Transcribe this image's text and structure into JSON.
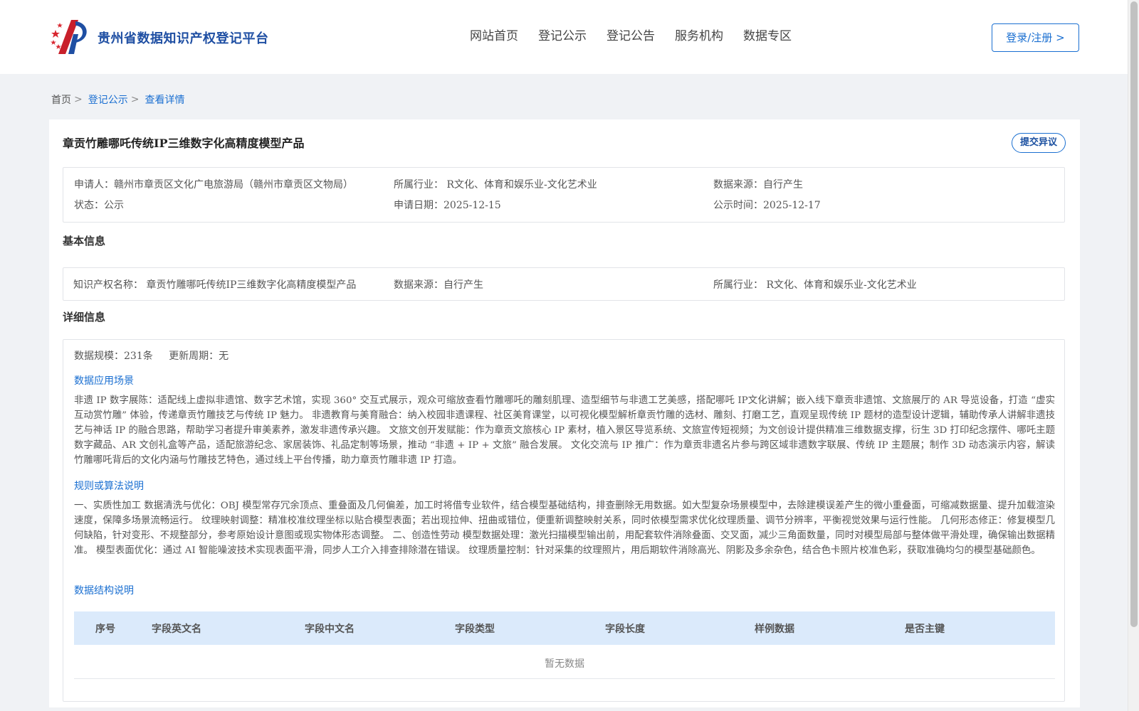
{
  "header": {
    "brand": "贵州省数据知识产权登记平台",
    "nav": [
      "网站首页",
      "登记公示",
      "登记公告",
      "服务机构",
      "数据专区"
    ],
    "login_label": "登录/注册 >"
  },
  "breadcrumb": {
    "home": "首页",
    "sep1": ">",
    "level2": "登记公示",
    "sep2": ">",
    "current": "查看详情"
  },
  "product": {
    "title": "章贡竹雕哪吒传统IP三维数字化高精度模型产品",
    "objection_label": "提交异议"
  },
  "summary": {
    "applicant": "申请人：赣州市章贡区文化广电旅游局（赣州市章贡区文物局）",
    "industry": "所属行业： R文化、体育和娱乐业-文化艺术业",
    "source": "数据来源：自行产生",
    "status": "状态：公示",
    "apply_date": "申请日期：2025-12-15",
    "publish_date": "公示时间：2025-12-17"
  },
  "basic": {
    "heading": "基本信息",
    "ip_name": "知识产权名称： 章贡竹雕哪吒传统IP三维数字化高精度模型产品",
    "source": "数据来源：自行产生",
    "industry": "所属行业： R文化、体育和娱乐业-文化艺术业"
  },
  "detail": {
    "heading": "详细信息",
    "scale": "数据规模：231条",
    "cycle": "更新周期：无",
    "scenario_heading": "数据应用场景",
    "scenario_text": "非遗 IP 数字展陈：适配线上虚拟非遗馆、数字艺术馆，实现 360° 交互式展示，观众可缩放查看竹雕哪吒的雕刻肌理、造型细节与非遗工艺美感，搭配哪吒 IP文化讲解；嵌入线下章贡非遗馆、文旅展厅的 AR 导览设备，打造 “虚实互动赏竹雕” 体验，传递章贡竹雕技艺与传统 IP 魅力。 非遗教育与美育融合：纳入校园非遗课程、社区美育课堂，以可视化模型解析章贡竹雕的选材、雕刻、打磨工艺，直观呈现传统 IP 题材的造型设计逻辑，辅助传承人讲解非遗技艺与神话 IP 的融合思路，帮助学习者提升审美素养，激发非遗传承兴趣。 文旅文创开发赋能：作为章贡文旅核心 IP 素材，植入景区导览系统、文旅宣传短视频；为文创设计提供精准三维数据支撑，衍生 3D 打印纪念摆件、哪吒主题数字藏品、AR 文创礼盒等产品，适配旅游纪念、家居装饰、礼品定制等场景，推动 “非遗 + IP + 文旅” 融合发展。 文化交流与 IP 推广：作为章贡非遗名片参与跨区域非遗数字联展、传统 IP 主题展；制作 3D 动态演示内容，解读竹雕哪吒背后的文化内涵与竹雕技艺特色，通过线上平台传播，助力章贡竹雕非遗 IP 打造。",
    "rules_heading": "规则或算法说明",
    "rules_text": "一、实质性加工 数据清洗与优化：OBJ 模型常存冗余顶点、重叠面及几何偏差，加工时将借专业软件，结合模型基础结构，排查删除无用数据。如大型复杂场景模型中，去除建模误差产生的微小重叠面，可缩减数据量、提升加载渲染速度，保障多场景流畅运行。 纹理映射调整：精准校准纹理坐标以贴合模型表面；若出现拉伸、扭曲或错位，便重新调整映射关系，同时依模型需求优化纹理质量、调节分辨率，平衡视觉效果与运行性能。 几何形态修正：修复模型几何缺陷，针对变形、不规整部分，参考原始设计意图或现实物体形态调整。 二、创造性劳动 模型数据处理：激光扫描模型输出前，用配套软件消除叠面、交叉面，减少三角面数量，同时对模型局部与整体做平滑处理，确保输出数据精准。 模型表面优化：通过 AI 智能噪波技术实现表面平滑，同步人工介入排查排除潜在错误。 纹理质量控制：针对采集的纹理照片，用后期软件消除高光、阴影及多余杂色，结合色卡照片校准色彩，获取准确均匀的模型基础颜色。",
    "structure_heading": "数据结构说明",
    "table_headers": [
      "序号",
      "字段英文名",
      "字段中文名",
      "字段类型",
      "字段长度",
      "样例数据",
      "是否主键"
    ],
    "empty_text": "暂无数据"
  },
  "colors": {
    "accent": "#1a6fd1",
    "brand": "#1f4fa3",
    "table_header_bg": "#dbeafb",
    "page_bg": "#f0f2f5"
  }
}
